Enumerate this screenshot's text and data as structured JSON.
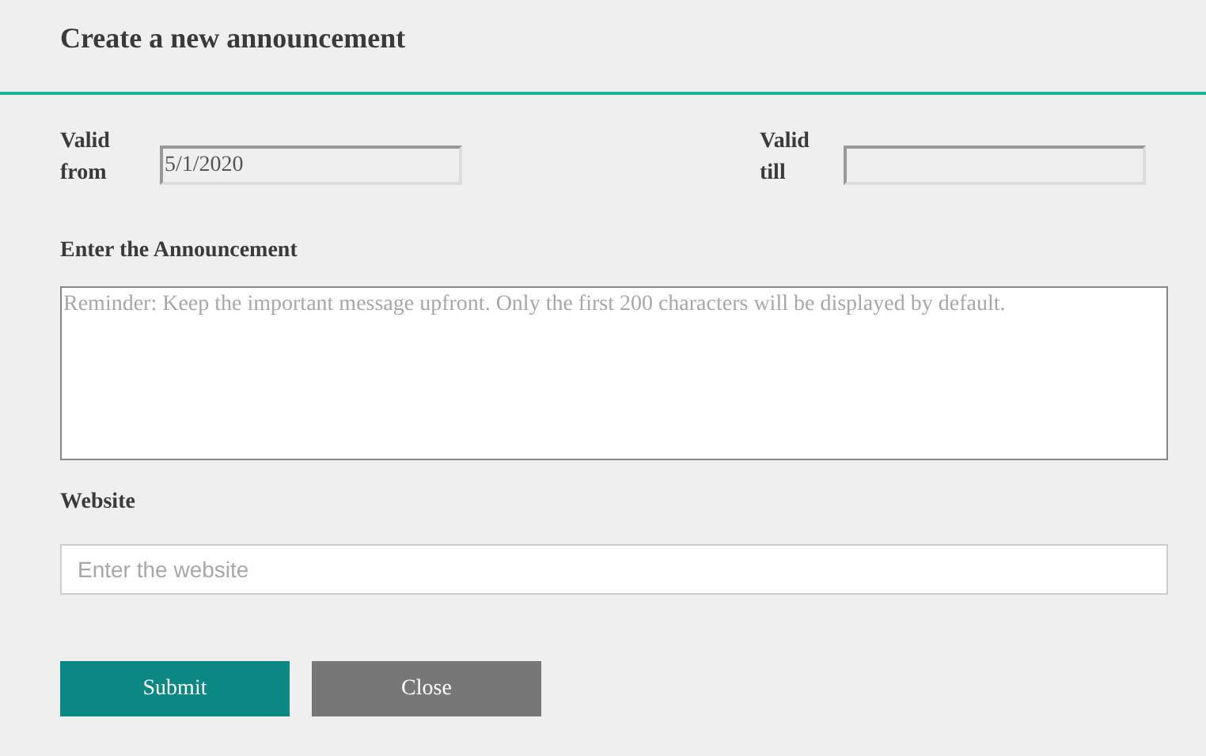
{
  "header": {
    "title": "Create a new announcement"
  },
  "dates": [
    {
      "label": "Valid from",
      "value": "5/1/2020"
    },
    {
      "label": "Valid till"
    }
  ],
  "announcement": {
    "label": "Enter the Announcement",
    "placeholder": "Reminder: Keep the important message upfront. Only the first 200 characters will be displayed by default."
  },
  "website": {
    "label": "Website",
    "placeholder": "Enter the website"
  },
  "buttons": [
    {
      "label": "Submit",
      "kind": "primary"
    },
    {
      "label": "Close",
      "kind": "secondary"
    }
  ]
}
